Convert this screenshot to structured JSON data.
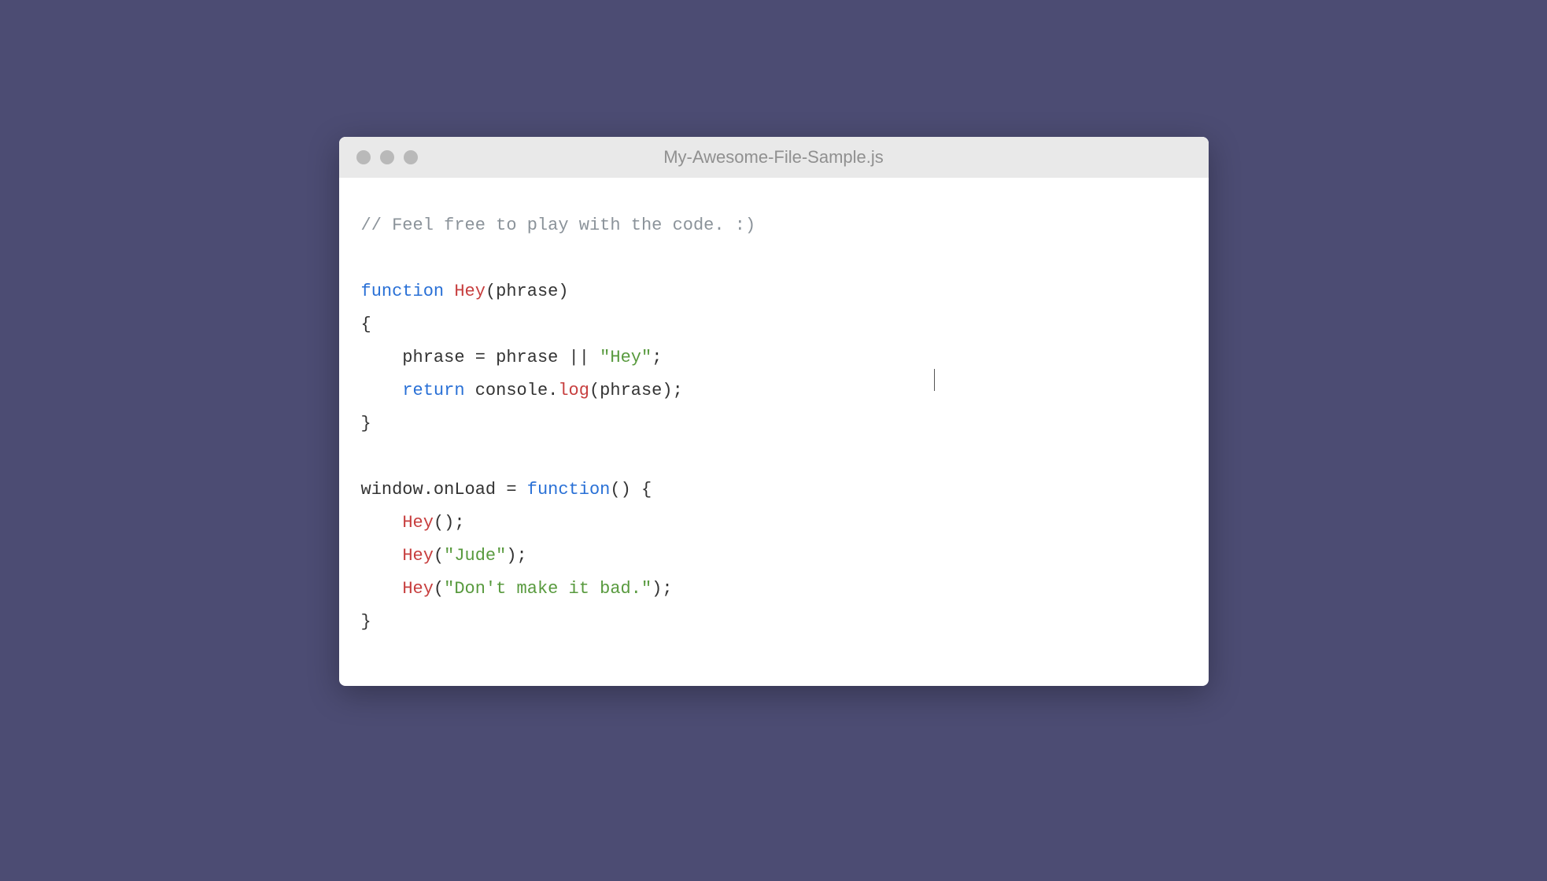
{
  "window": {
    "title": "My-Awesome-File-Sample.js"
  },
  "code": {
    "tokens": [
      [
        {
          "class": "tok-comment",
          "text": "// Feel free to play with the code. :)"
        }
      ],
      [],
      [
        {
          "class": "tok-keyword",
          "text": "function"
        },
        {
          "class": "",
          "text": " "
        },
        {
          "class": "tok-funcname",
          "text": "Hey"
        },
        {
          "class": "tok-punct",
          "text": "(phrase)"
        }
      ],
      [
        {
          "class": "tok-punct",
          "text": "{"
        }
      ],
      [
        {
          "class": "",
          "text": "    phrase "
        },
        {
          "class": "tok-operator",
          "text": "="
        },
        {
          "class": "",
          "text": " phrase "
        },
        {
          "class": "tok-operator",
          "text": "||"
        },
        {
          "class": "",
          "text": " "
        },
        {
          "class": "tok-string",
          "text": "\"Hey\""
        },
        {
          "class": "tok-punct",
          "text": ";"
        }
      ],
      [
        {
          "class": "",
          "text": "    "
        },
        {
          "class": "tok-return",
          "text": "return"
        },
        {
          "class": "",
          "text": " console."
        },
        {
          "class": "tok-method",
          "text": "log"
        },
        {
          "class": "tok-punct",
          "text": "(phrase);"
        }
      ],
      [
        {
          "class": "tok-punct",
          "text": "}"
        }
      ],
      [],
      [
        {
          "class": "",
          "text": "window.onLoad "
        },
        {
          "class": "tok-operator",
          "text": "="
        },
        {
          "class": "",
          "text": " "
        },
        {
          "class": "tok-keyword",
          "text": "function"
        },
        {
          "class": "tok-punct",
          "text": "() {"
        }
      ],
      [
        {
          "class": "",
          "text": "    "
        },
        {
          "class": "tok-funccall",
          "text": "Hey"
        },
        {
          "class": "tok-punct",
          "text": "();"
        }
      ],
      [
        {
          "class": "",
          "text": "    "
        },
        {
          "class": "tok-funccall",
          "text": "Hey"
        },
        {
          "class": "tok-punct",
          "text": "("
        },
        {
          "class": "tok-string",
          "text": "\"Jude\""
        },
        {
          "class": "tok-punct",
          "text": ");"
        }
      ],
      [
        {
          "class": "",
          "text": "    "
        },
        {
          "class": "tok-funccall",
          "text": "Hey"
        },
        {
          "class": "tok-punct",
          "text": "("
        },
        {
          "class": "tok-string",
          "text": "\"Don't make it bad.\""
        },
        {
          "class": "tok-punct",
          "text": ");"
        }
      ],
      [
        {
          "class": "tok-punct",
          "text": "}"
        }
      ]
    ]
  }
}
